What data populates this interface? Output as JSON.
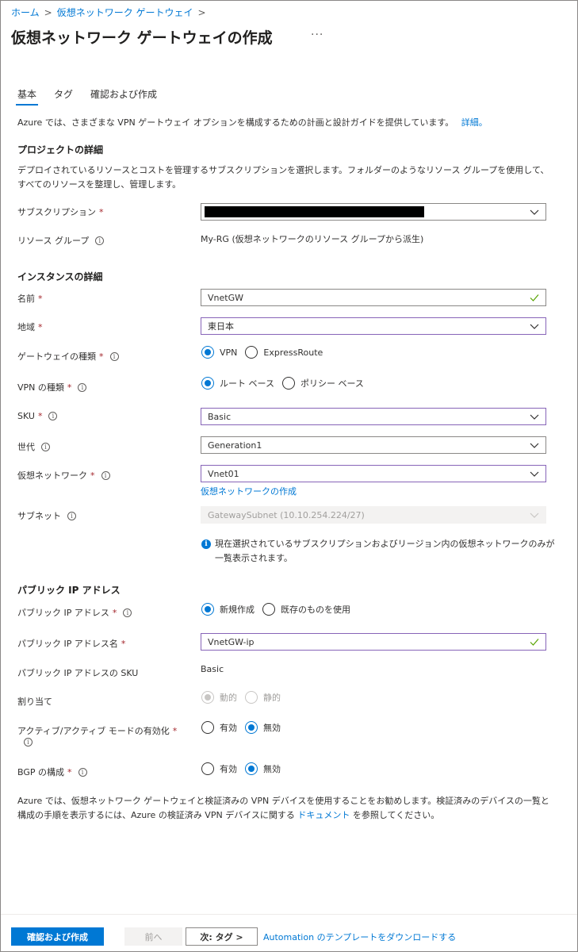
{
  "breadcrumb": {
    "home": "ホーム",
    "current": "仮想ネットワーク ゲートウェイ",
    "separator": ">"
  },
  "page": {
    "title": "仮想ネットワーク ゲートウェイの作成",
    "more": "···"
  },
  "tabs": [
    {
      "label": "基本",
      "selected": true
    },
    {
      "label": "タグ",
      "selected": false
    },
    {
      "label": "確認および作成",
      "selected": false
    }
  ],
  "intro": {
    "text": "Azure では、さまざまな VPN ゲートウェイ オプションを構成するための計画と設計ガイドを提供しています。",
    "link": "詳細。"
  },
  "project": {
    "heading": "プロジェクトの詳細",
    "description": "デプロイされているリソースとコストを管理するサブスクリプションを選択します。フォルダーのようなリソース グループを使用して、すべてのリソースを整理し、管理します。",
    "subscription_label": "サブスクリプション",
    "resource_group_label": "リソース グループ",
    "resource_group_value": "My-RG (仮想ネットワークのリソース グループから派生)"
  },
  "instance": {
    "heading": "インスタンスの詳細",
    "name_label": "名前",
    "name_value": "VnetGW",
    "region_label": "地域",
    "region_value": "東日本",
    "gateway_type_label": "ゲートウェイの種類",
    "gateway_type_options": [
      "VPN",
      "ExpressRoute"
    ],
    "vpn_type_label": "VPN の種類",
    "vpn_type_options": [
      "ルート ベース",
      "ポリシー ベース"
    ],
    "sku_label": "SKU",
    "sku_value": "Basic",
    "generation_label": "世代",
    "generation_value": "Generation1",
    "vnet_label": "仮想ネットワーク",
    "vnet_value": "Vnet01",
    "vnet_create_link": "仮想ネットワークの作成",
    "subnet_label": "サブネット",
    "subnet_value": "GatewaySubnet (10.10.254.224/27)",
    "note_icon": "i",
    "note": "現在選択されているサブスクリプションおよびリージョン内の仮想ネットワークのみが一覧表示されます。"
  },
  "public_ip": {
    "heading": "パブリック IP アドレス",
    "address_label": "パブリック IP アドレス",
    "address_options": [
      "新規作成",
      "既存のものを使用"
    ],
    "name_label": "パブリック IP アドレス名",
    "name_value": "VnetGW-ip",
    "sku_label": "パブリック IP アドレスの SKU",
    "sku_value": "Basic",
    "assignment_label": "割り当て",
    "assignment_options": [
      "動的",
      "静的"
    ],
    "active_label": "アクティブ/アクティブ モードの有効化",
    "active_options": [
      "有効",
      "無効"
    ],
    "bgp_label": "BGP の構成",
    "bgp_options": [
      "有効",
      "無効"
    ]
  },
  "outro": {
    "text_before": "Azure では、仮想ネットワーク ゲートウェイと検証済みの VPN デバイスを使用することをお勧めします。検証済みのデバイスの一覧と構成の手順を表示するには、Azure の検証済み VPN デバイスに関する",
    "link": "ドキュメント",
    "text_after": "を参照してください。"
  },
  "footer": {
    "review_create": "確認および作成",
    "previous": "前へ",
    "next": "次: タグ >",
    "automation_link": "Automation のテンプレートをダウンロードする"
  },
  "common": {
    "required_mark": "*",
    "info_glyph": "i"
  },
  "colors": {
    "accent": "#0078d4",
    "focus_border": "#8764b8",
    "success": "#57a300",
    "required": "#a4262c"
  }
}
